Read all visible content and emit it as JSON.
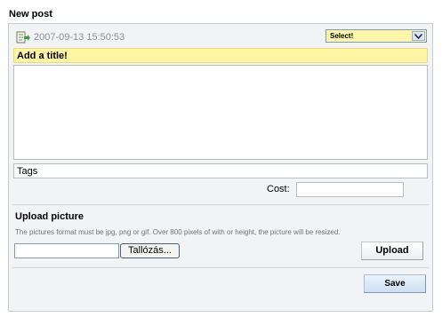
{
  "page": {
    "title": "New post"
  },
  "post": {
    "icon": "document-arrow-icon",
    "timestamp": "2007-09-13 15:50:53",
    "category_select": {
      "value": "Select!"
    },
    "title_placeholder": "Add a title!",
    "body": "",
    "tags_value": "Tags",
    "cost_label": "Cost:",
    "cost_value": ""
  },
  "upload": {
    "heading": "Upload picture",
    "hint": "The pictures format must be jpg, png or gif. Over 800 pixels of with or height, the picture will be resized.",
    "file_path": "",
    "browse_label": "Tallózás...",
    "upload_label": "Upload"
  },
  "actions": {
    "save_label": "Save"
  },
  "colors": {
    "title_highlight": "#fff5a3",
    "select_background": "#fff6a8",
    "save_button": "#cfe0f2",
    "panel_background": "#f1f3f5"
  }
}
